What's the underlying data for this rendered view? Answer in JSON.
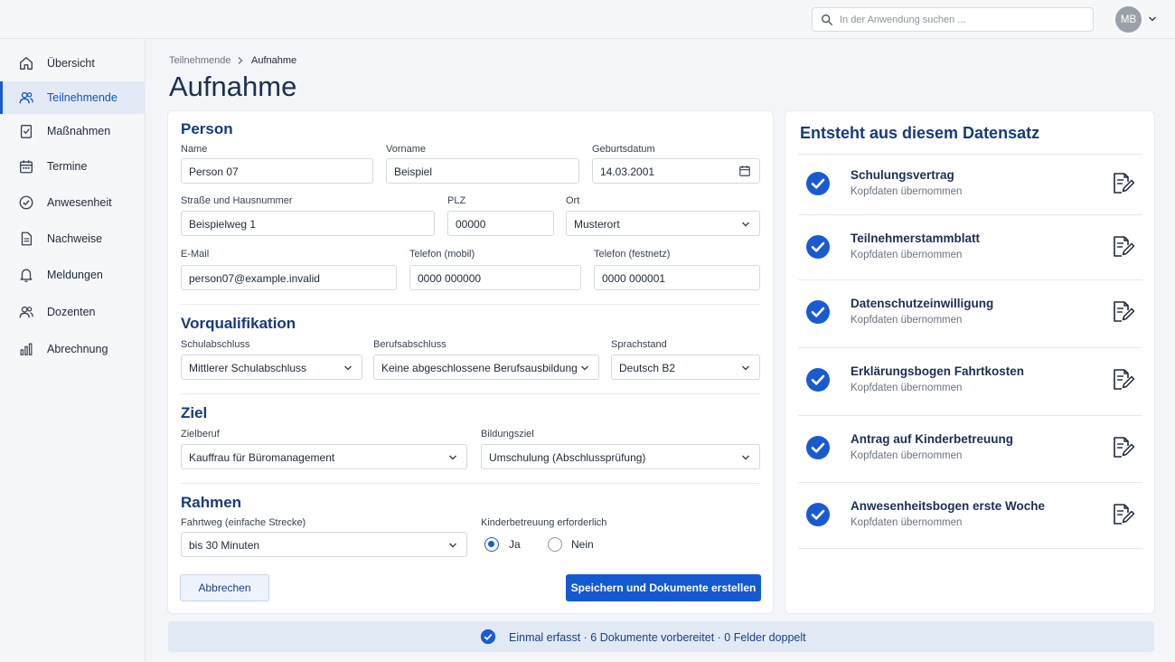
{
  "search": {
    "placeholder": "In der Anwendung suchen ..."
  },
  "user": {
    "initials": "MB"
  },
  "sidebar": {
    "items": [
      {
        "label": "Übersicht",
        "icon": "home-icon",
        "active": false
      },
      {
        "label": "Teilnehmende",
        "icon": "users-icon",
        "active": true
      },
      {
        "label": "Maßnahmen",
        "icon": "clipboard-check-icon",
        "active": false
      },
      {
        "label": "Termine",
        "icon": "calendar-icon",
        "active": false
      },
      {
        "label": "Anwesenheit",
        "icon": "check-circle-icon",
        "active": false
      },
      {
        "label": "Nachweise",
        "icon": "document-icon",
        "active": false
      },
      {
        "label": "Meldungen",
        "icon": "bell-icon",
        "active": false
      },
      {
        "label": "Dozenten",
        "icon": "people-icon",
        "active": false
      },
      {
        "label": "Abrechnung",
        "icon": "bar-chart-icon",
        "active": false
      }
    ]
  },
  "breadcrumb": {
    "parent": "Teilnehmende",
    "current": "Aufnahme"
  },
  "page": {
    "title": "Aufnahme"
  },
  "form": {
    "person": {
      "heading": "Person",
      "name": {
        "label": "Name",
        "value": "Person 07"
      },
      "vorname": {
        "label": "Vorname",
        "value": "Beispiel"
      },
      "geburtsdatum": {
        "label": "Geburtsdatum",
        "value": "14.03.2001"
      },
      "strasse": {
        "label": "Straße und Hausnummer",
        "value": "Beispielweg 1"
      },
      "plz": {
        "label": "PLZ",
        "value": "00000"
      },
      "ort": {
        "label": "Ort",
        "value": "Musterort"
      },
      "email": {
        "label": "E-Mail",
        "value": "person07@example.invalid"
      },
      "tel_mobil": {
        "label": "Telefon (mobil)",
        "value": "0000 000000"
      },
      "tel_fest": {
        "label": "Telefon (festnetz)",
        "value": "0000 000001"
      }
    },
    "vorqualifikation": {
      "heading": "Vorqualifikation",
      "schulabschluss": {
        "label": "Schulabschluss",
        "value": "Mittlerer Schulabschluss"
      },
      "berufsabschluss": {
        "label": "Berufsabschluss",
        "value": "Keine abgeschlossene Berufsausbildung"
      },
      "sprachstand": {
        "label": "Sprachstand",
        "value": "Deutsch B2"
      }
    },
    "ziel": {
      "heading": "Ziel",
      "zielberuf": {
        "label": "Zielberuf",
        "value": "Kauffrau für Büromanagement"
      },
      "bildungsziel": {
        "label": "Bildungsziel",
        "value": "Umschulung (Abschlussprüfung)"
      }
    },
    "rahmen": {
      "heading": "Rahmen",
      "fahrtweg": {
        "label": "Fahrtweg (einfache Strecke)",
        "value": "bis 30 Minuten"
      },
      "kinderbetreuung": {
        "label": "Kinderbetreuung erforderlich",
        "option_yes": "Ja",
        "option_no": "Nein",
        "selected": "Ja"
      }
    },
    "cancel_label": "Abbrechen",
    "submit_label": "Speichern und Dokumente erstellen"
  },
  "documents": {
    "heading": "Entsteht aus diesem Datensatz",
    "items": [
      {
        "name": "Schulungsvertrag",
        "status": "Kopfdaten übernommen"
      },
      {
        "name": "Teilnehmerstammblatt",
        "status": "Kopfdaten übernommen"
      },
      {
        "name": "Datenschutzeinwilligung",
        "status": "Kopfdaten übernommen"
      },
      {
        "name": "Erklärungsbogen Fahrtkosten",
        "status": "Kopfdaten übernommen"
      },
      {
        "name": "Antrag auf Kinderbetreuung",
        "status": "Kopfdaten übernommen"
      },
      {
        "name": "Anwesenheitsbogen erste Woche",
        "status": "Kopfdaten übernommen"
      }
    ]
  },
  "status_bar": {
    "text": "Einmal erfasst  ·  6 Dokumente vorbereitet  ·  0 Felder doppelt"
  },
  "colors": {
    "accent": "#1459d0",
    "heading": "#183a78",
    "check": "#1a5ad1"
  }
}
